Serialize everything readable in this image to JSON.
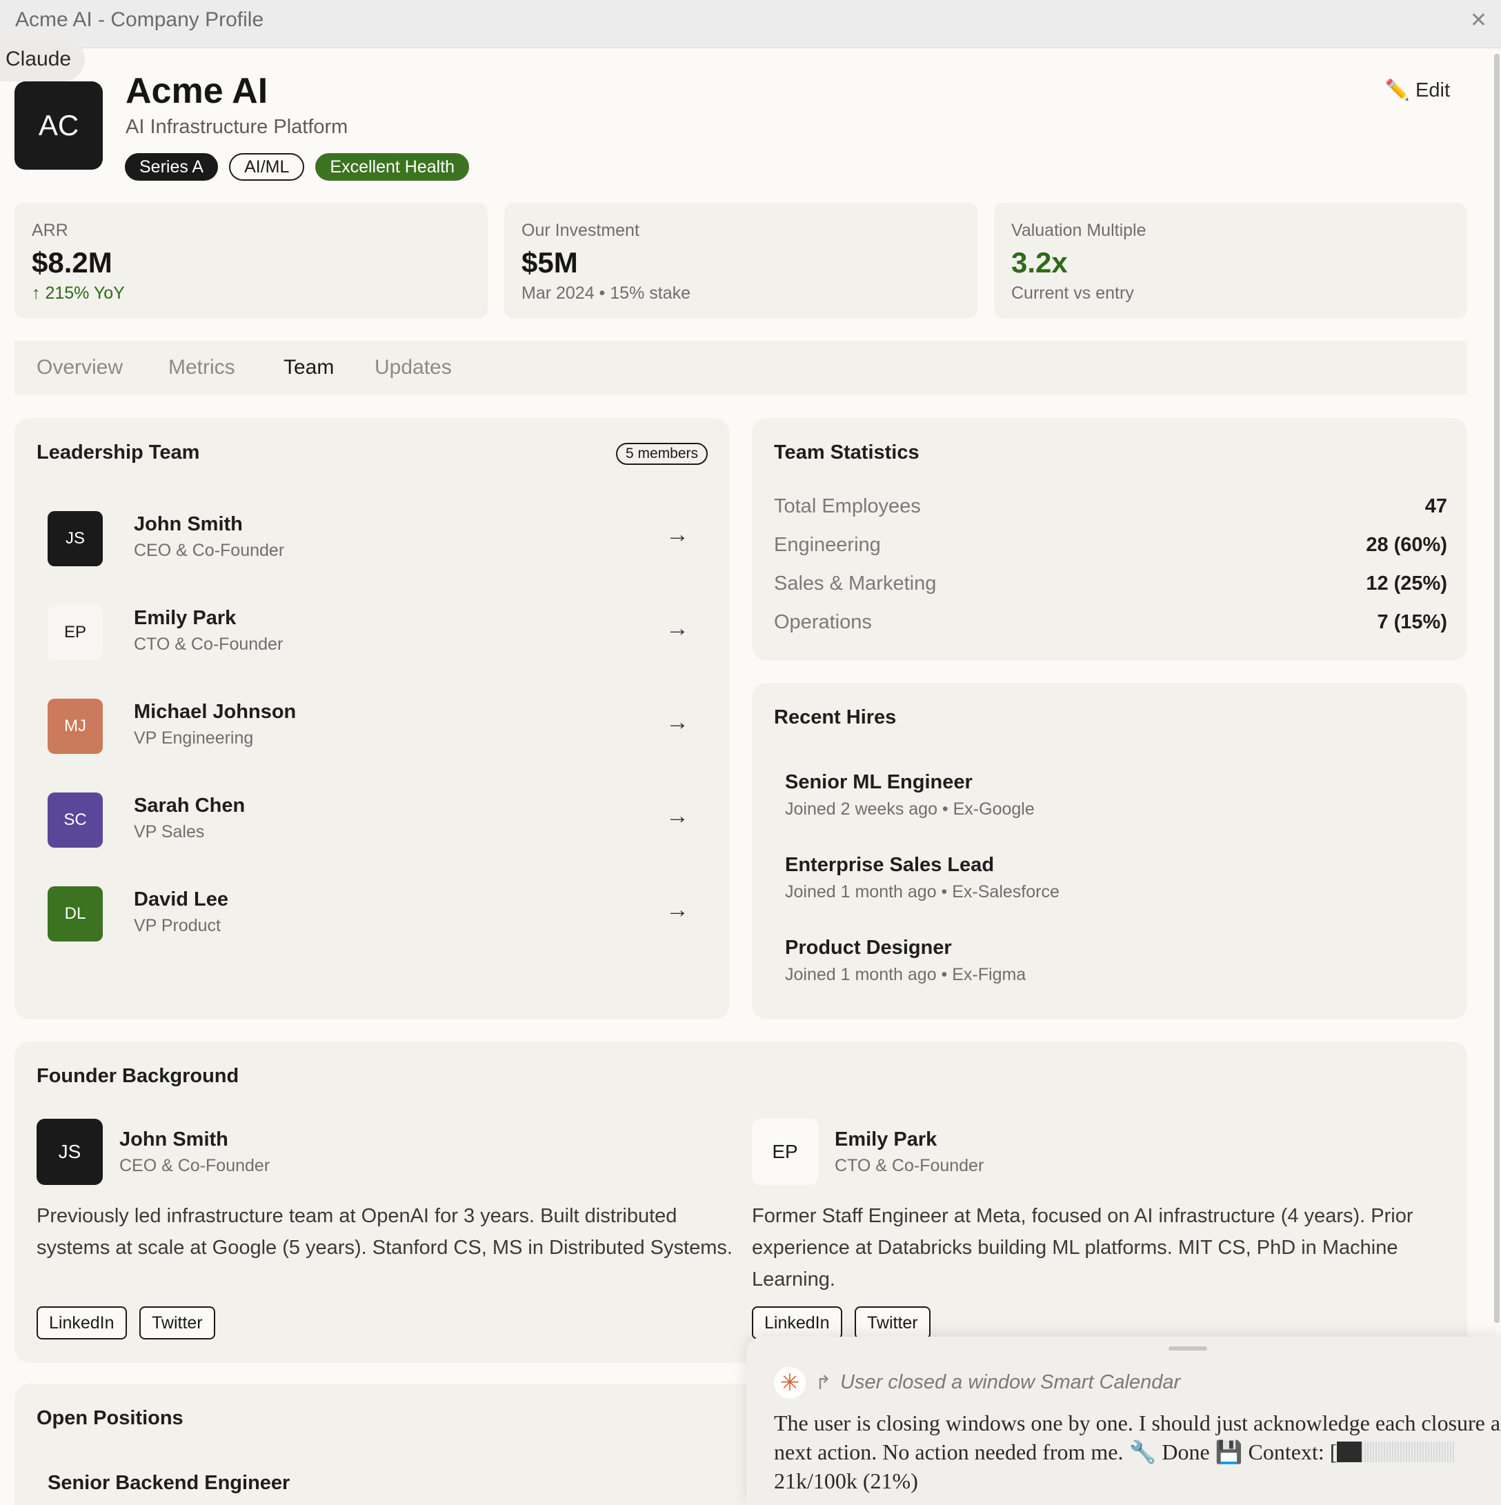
{
  "window": {
    "title": "Acme AI - Company Profile",
    "close_glyph": "✕"
  },
  "claude_tab": {
    "label": "Claude"
  },
  "header": {
    "initials": "AC",
    "name": "Acme AI",
    "subtitle": "AI Infrastructure Platform",
    "badges": [
      "Series A",
      "AI/ML",
      "Excellent Health"
    ],
    "edit_label": "✏️ Edit"
  },
  "stats": [
    {
      "label": "ARR",
      "value": "$8.2M",
      "sub": "↑ 215% YoY"
    },
    {
      "label": "Our Investment",
      "value": "$5M",
      "sub": "Mar 2024 • 15% stake"
    },
    {
      "label": "Valuation Multiple",
      "value": "3.2x",
      "sub": "Current vs entry"
    }
  ],
  "tabs": [
    "Overview",
    "Metrics",
    "Team",
    "Updates"
  ],
  "active_tab": "Team",
  "leadership": {
    "title": "Leadership Team",
    "count": "5 members",
    "members": [
      {
        "initials": "JS",
        "name": "John Smith",
        "role": "CEO & Co-Founder",
        "color": "#1a1a1a"
      },
      {
        "initials": "EP",
        "name": "Emily Park",
        "role": "CTO & Co-Founder",
        "color": "#f7f6f2"
      },
      {
        "initials": "MJ",
        "name": "Michael Johnson",
        "role": "VP Engineering",
        "color": "#cc7a5c"
      },
      {
        "initials": "SC",
        "name": "Sarah Chen",
        "role": "VP Sales",
        "color": "#5a479a"
      },
      {
        "initials": "DL",
        "name": "David Lee",
        "role": "VP Product",
        "color": "#3c7321"
      }
    ],
    "arrow_glyph": "→"
  },
  "team_stats": {
    "title": "Team Statistics",
    "rows": [
      {
        "label": "Total Employees",
        "value": "47"
      },
      {
        "label": "Engineering",
        "value": "28 (60%)"
      },
      {
        "label": "Sales & Marketing",
        "value": "12 (25%)"
      },
      {
        "label": "Operations",
        "value": "7 (15%)"
      }
    ]
  },
  "recent_hires": {
    "title": "Recent Hires",
    "items": [
      {
        "title": "Senior ML Engineer",
        "sub": "Joined 2 weeks ago • Ex-Google"
      },
      {
        "title": "Enterprise Sales Lead",
        "sub": "Joined 1 month ago • Ex-Salesforce"
      },
      {
        "title": "Product Designer",
        "sub": "Joined 1 month ago • Ex-Figma"
      }
    ]
  },
  "founders": {
    "title": "Founder Background",
    "people": [
      {
        "initials": "JS",
        "name": "John Smith",
        "role": "CEO & Co-Founder",
        "bio": "Previously led infrastructure team at OpenAI for 3 years. Built distributed systems at scale at Google (5 years). Stanford CS, MS in Distributed Systems.",
        "links": [
          "LinkedIn",
          "Twitter"
        ]
      },
      {
        "initials": "EP",
        "name": "Emily Park",
        "role": "CTO & Co-Founder",
        "bio": "Former Staff Engineer at Meta, focused on AI infrastructure (4 years). Prior experience at Databricks building ML platforms. MIT CS, PhD in Machine Learning.",
        "links": [
          "LinkedIn",
          "Twitter"
        ]
      }
    ]
  },
  "open_positions": {
    "title": "Open Positions",
    "items": [
      "Senior Backend Engineer"
    ]
  },
  "assistant_overlay": {
    "icon": "✳",
    "event_glyph": "↱",
    "event_text": "User closed a window Smart Calendar",
    "message": "The user is closing windows one by one. I should just acknowledge each closure a the next action. No action needed from me. 🔧 Done 💾 Context: [",
    "context_usage": "21k/100k (21%)",
    "context_fraction": 0.21
  },
  "colors": {
    "accent_dark": "#1a1a1a",
    "health_green": "#3c7321",
    "panel_bg": "#f3f1ec",
    "page_bg": "#fbfaf7"
  }
}
